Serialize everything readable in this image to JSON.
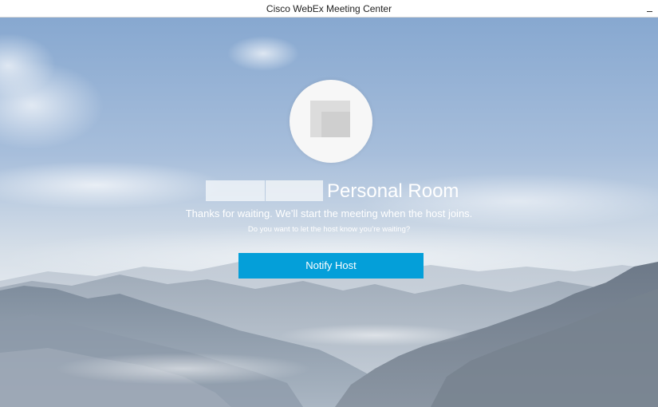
{
  "window": {
    "title": "Cisco WebEx Meeting Center",
    "minimize_icon": "minimize-icon"
  },
  "host": {
    "avatar_icon": "avatar-placeholder-icon",
    "room_suffix": "Personal Room"
  },
  "messages": {
    "thanks": "Thanks for waiting. We’ll start the meeting when the host joins.",
    "ask": "Do you want to let the host know you’re waiting?"
  },
  "actions": {
    "notify_label": "Notify Host"
  },
  "colors": {
    "accent": "#049fd9",
    "sky_top": "#8fb0d6",
    "mountain": "#6f7c8c"
  }
}
